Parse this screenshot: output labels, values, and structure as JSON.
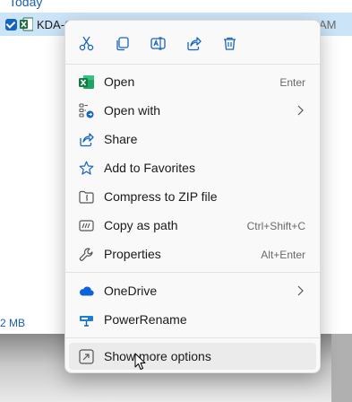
{
  "explorer": {
    "group_header": "Today",
    "file_name": "KDA-C",
    "file_time": "AM",
    "status_size": "2 MB"
  },
  "quick_actions": [
    {
      "name": "cut-icon"
    },
    {
      "name": "copy-icon"
    },
    {
      "name": "rename-icon"
    },
    {
      "name": "share-icon"
    },
    {
      "name": "delete-icon"
    }
  ],
  "menu": {
    "open": {
      "label": "Open",
      "shortcut": "Enter",
      "icon": "excel-icon"
    },
    "open_with": {
      "label": "Open with",
      "icon": "open-with-icon"
    },
    "share": {
      "label": "Share",
      "icon": "share-icon"
    },
    "favorites": {
      "label": "Add to Favorites",
      "icon": "star-icon"
    },
    "compress": {
      "label": "Compress to ZIP file",
      "icon": "zip-folder-icon"
    },
    "copy_path": {
      "label": "Copy as path",
      "shortcut": "Ctrl+Shift+C",
      "icon": "copy-path-icon"
    },
    "properties": {
      "label": "Properties",
      "shortcut": "Alt+Enter",
      "icon": "wrench-icon"
    },
    "onedrive": {
      "label": "OneDrive",
      "icon": "cloud-icon"
    },
    "powerrename": {
      "label": "PowerRename",
      "icon": "powerrename-icon"
    },
    "more": {
      "label": "Show more options",
      "icon": "more-options-icon"
    }
  },
  "colors": {
    "accent": "#1565c0",
    "excel_green": "#1d6f42",
    "menu_bg": "#f9f9f9",
    "onedrive_blue": "#0a64d8"
  }
}
